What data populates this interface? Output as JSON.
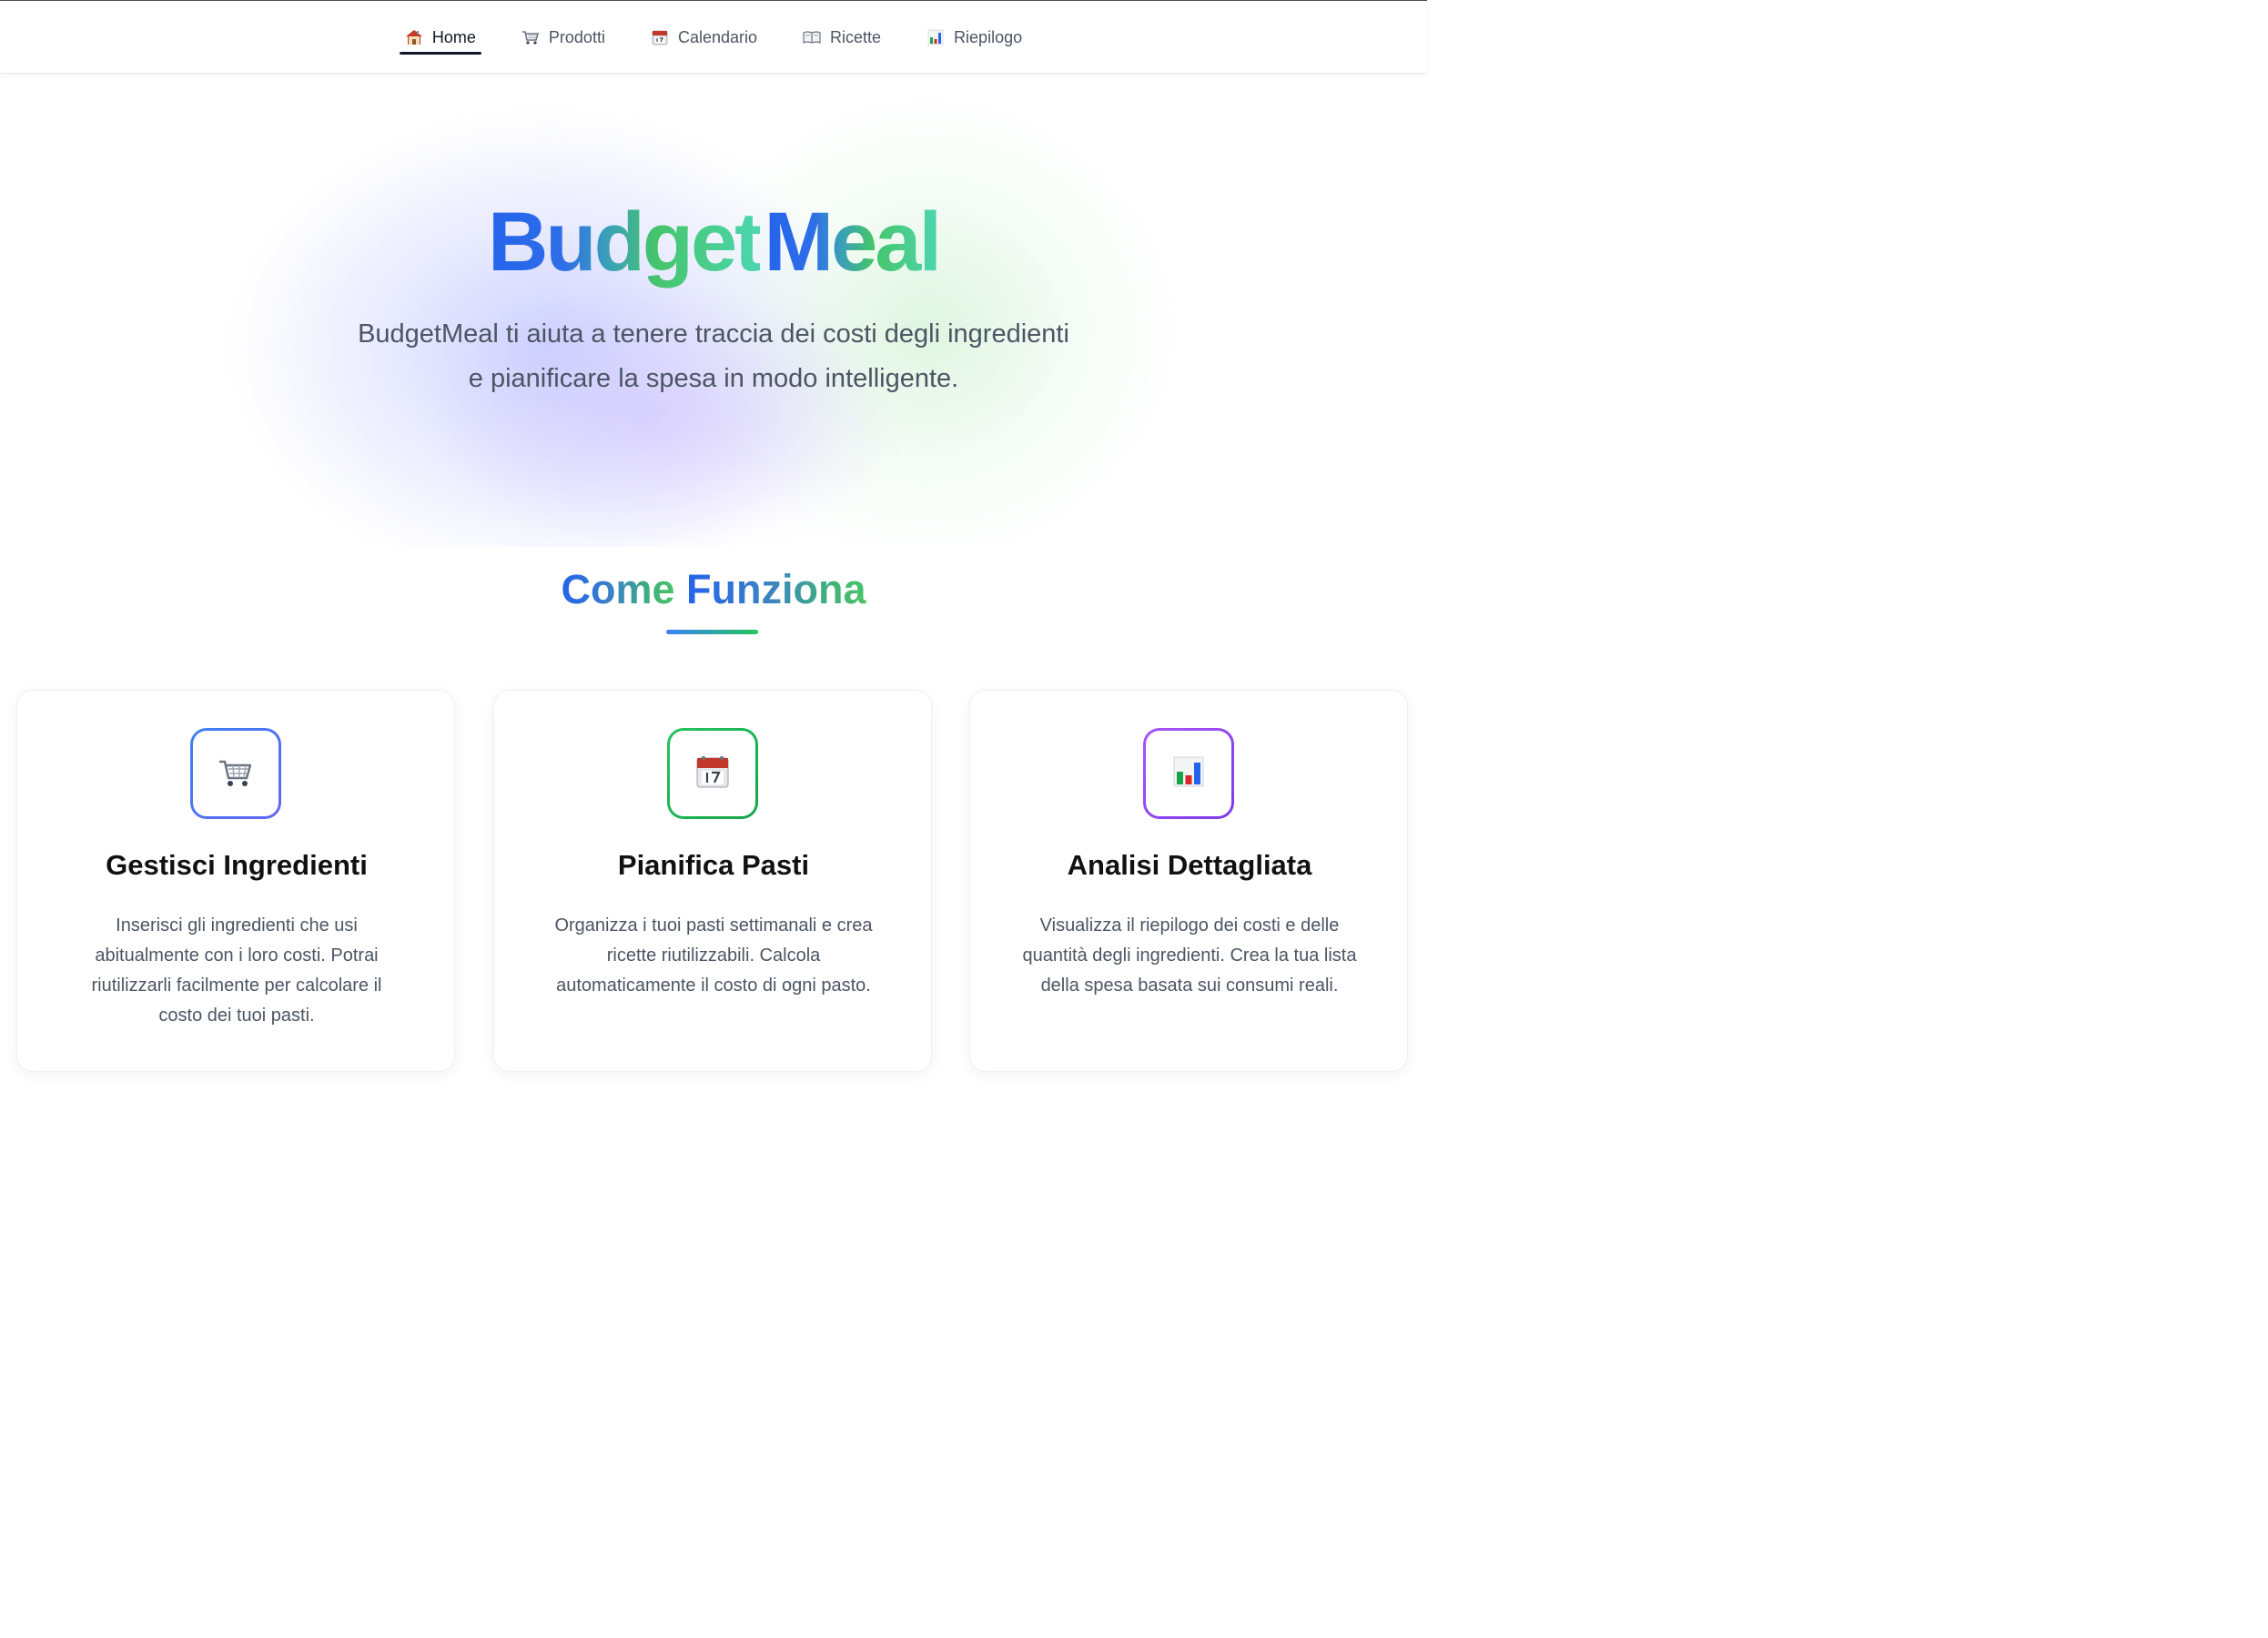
{
  "nav": {
    "items": [
      {
        "label": "Home",
        "icon": "house-icon",
        "active": true
      },
      {
        "label": "Prodotti",
        "icon": "cart-icon",
        "active": false
      },
      {
        "label": "Calendario",
        "icon": "calendar-icon",
        "active": false
      },
      {
        "label": "Ricette",
        "icon": "book-icon",
        "active": false
      },
      {
        "label": "Riepilogo",
        "icon": "bar-chart-icon",
        "active": false
      }
    ]
  },
  "hero": {
    "brand_part1": "Budget",
    "brand_part2": "Meal",
    "tagline": "BudgetMeal ti aiuta a tenere traccia dei costi degli ingredienti e pianificare la spesa in modo intelligente."
  },
  "how_it_works": {
    "title_part1": "Come",
    "title_part2": "Funziona"
  },
  "cards": [
    {
      "icon": "cart-icon",
      "title": "Gestisci Ingredienti",
      "text": "Inserisci gli ingredienti che usi abitualmente con i loro costi. Potrai riutilizzarli facilmente per calcolare il costo dei tuoi pasti.",
      "accent": "#4f6ef7"
    },
    {
      "icon": "calendar-icon",
      "title": "Pianifica Pasti",
      "text": "Organizza i tuoi pasti settimanali e crea ricette riutilizzabili. Calcola automaticamente il costo di ogni pasto.",
      "accent": "#22c55e"
    },
    {
      "icon": "bar-chart-icon",
      "title": "Analisi Dettagliata",
      "text": "Visualizza il riepilogo dei costi e delle quantità degli ingredienti. Crea la tua lista della spesa basata sui consumi reali.",
      "accent": "#9333ea"
    }
  ],
  "colors": {
    "brand_blue": "#2563eb",
    "brand_green": "#45c56a",
    "text_muted": "#4b5563"
  }
}
